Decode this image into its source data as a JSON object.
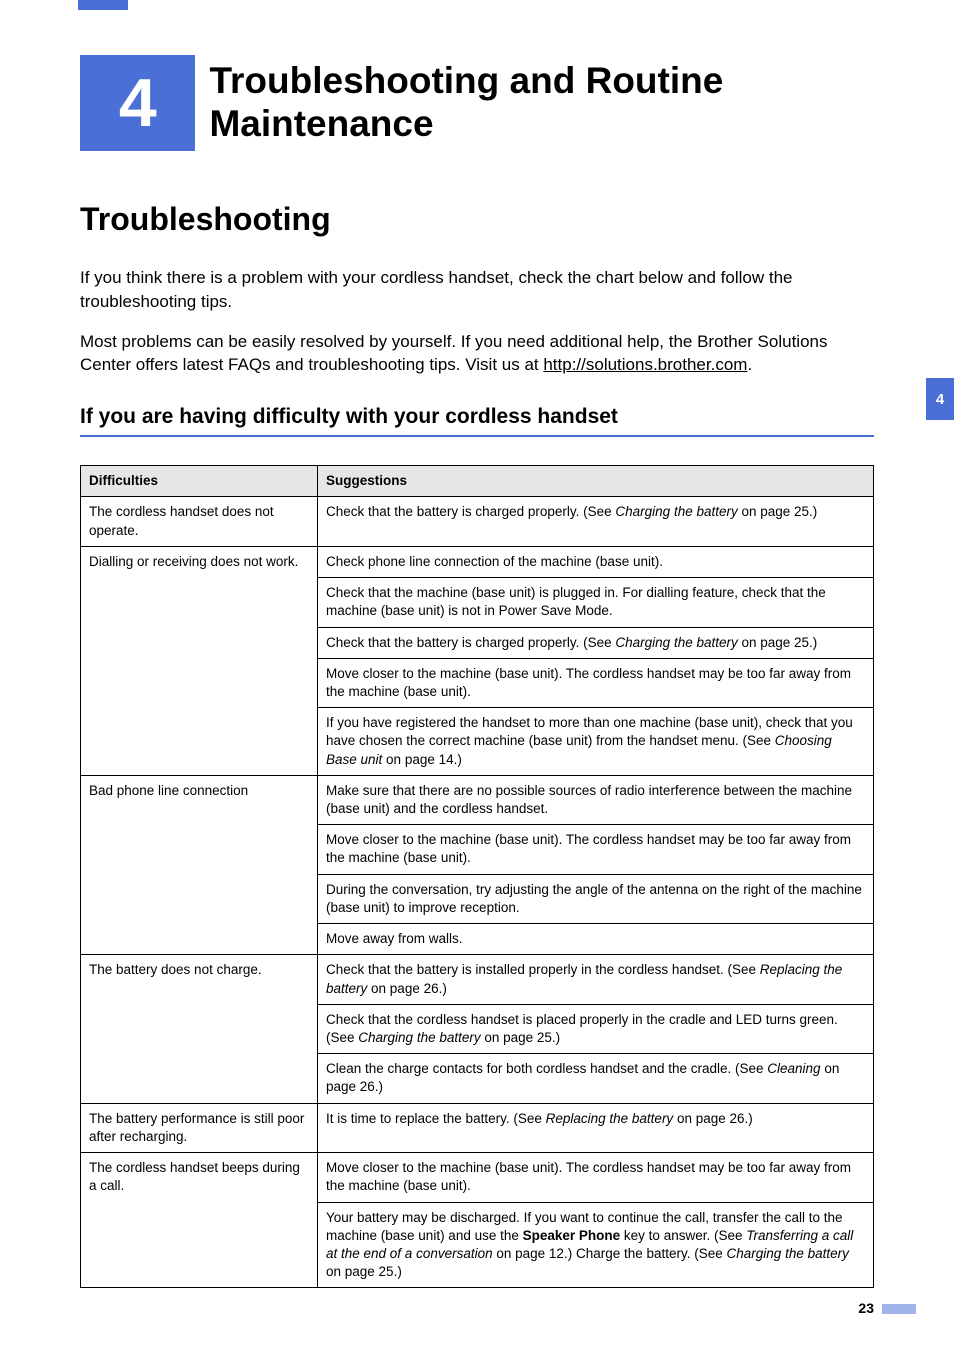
{
  "chapter": {
    "number": "4",
    "title": "Troubleshooting and Routine Maintenance"
  },
  "section": {
    "title": "Troubleshooting"
  },
  "paras": {
    "p1": "If you think there is a problem with your cordless handset, check the chart below and follow the troubleshooting tips.",
    "p2a": "Most problems can be easily resolved by yourself. If you need additional help, the Brother Solutions Center offers latest FAQs and troubleshooting tips. Visit us at ",
    "p2link": "http://solutions.brother.com",
    "p2b": "."
  },
  "subsection": {
    "title": "If you are having difficulty with your cordless handset"
  },
  "sideTab": "4",
  "tableHeaders": {
    "col1": "Difficulties",
    "col2": "Suggestions"
  },
  "rows": [
    {
      "difficulty": "The cordless handset does not operate.",
      "suggestions": [
        {
          "segments": [
            {
              "t": "Check that the battery is charged properly. (See "
            },
            {
              "t": "Charging the battery",
              "style": "italic"
            },
            {
              "t": " on page 25.)"
            }
          ]
        }
      ]
    },
    {
      "difficulty": "Dialling or receiving does not work.",
      "suggestions": [
        {
          "segments": [
            {
              "t": "Check phone line connection of the machine (base unit)."
            }
          ]
        },
        {
          "segments": [
            {
              "t": "Check that the machine (base unit) is plugged in. For dialling feature, check that the machine (base unit) is not in Power Save Mode."
            }
          ]
        },
        {
          "segments": [
            {
              "t": "Check that the battery is charged properly. (See "
            },
            {
              "t": "Charging the battery",
              "style": "italic"
            },
            {
              "t": " on page 25.)"
            }
          ]
        },
        {
          "segments": [
            {
              "t": "Move closer to the machine (base unit). The cordless handset may be too far away from the machine (base unit)."
            }
          ]
        },
        {
          "segments": [
            {
              "t": "If you have registered the handset to more than one machine (base unit), check that you have chosen the correct machine (base unit) from the handset menu. (See "
            },
            {
              "t": "Choosing Base unit",
              "style": "italic"
            },
            {
              "t": " on page 14.)"
            }
          ]
        }
      ]
    },
    {
      "difficulty": "Bad phone line connection",
      "suggestions": [
        {
          "segments": [
            {
              "t": "Make sure that there are no possible sources of radio interference between the machine (base unit) and the cordless handset."
            }
          ]
        },
        {
          "segments": [
            {
              "t": "Move closer to the machine (base unit). The cordless handset may be too far away from the machine (base unit)."
            }
          ]
        },
        {
          "segments": [
            {
              "t": "During the conversation, try adjusting the angle of the antenna on the right of the machine (base unit) to improve reception."
            }
          ]
        },
        {
          "segments": [
            {
              "t": "Move away from walls."
            }
          ]
        }
      ]
    },
    {
      "difficulty": "The battery does not charge.",
      "suggestions": [
        {
          "segments": [
            {
              "t": "Check that the battery is installed properly in the cordless handset. (See "
            },
            {
              "t": "Replacing the battery",
              "style": "italic"
            },
            {
              "t": " on page 26.)"
            }
          ]
        },
        {
          "segments": [
            {
              "t": "Check that the cordless handset is placed properly in the cradle and LED turns green. (See "
            },
            {
              "t": "Charging the battery",
              "style": "italic"
            },
            {
              "t": " on page 25.)"
            }
          ]
        },
        {
          "segments": [
            {
              "t": "Clean the charge contacts for both cordless handset and the cradle. (See "
            },
            {
              "t": "Cleaning",
              "style": "italic"
            },
            {
              "t": " on page 26.)"
            }
          ]
        }
      ]
    },
    {
      "difficulty": "The battery performance is still poor after recharging.",
      "suggestions": [
        {
          "segments": [
            {
              "t": "It is time to replace the battery. (See "
            },
            {
              "t": "Replacing the battery",
              "style": "italic"
            },
            {
              "t": " on page 26.)"
            }
          ]
        }
      ]
    },
    {
      "difficulty": "The cordless handset beeps during a call.",
      "suggestions": [
        {
          "segments": [
            {
              "t": "Move closer to the machine (base unit). The cordless handset may be too far away from the machine (base unit)."
            }
          ]
        },
        {
          "segments": [
            {
              "t": "Your battery may be discharged. If you want to continue the call, transfer the call to the machine (base unit) and use the "
            },
            {
              "t": "Speaker Phone",
              "style": "bold"
            },
            {
              "t": " key to answer. (See "
            },
            {
              "t": "Transferring a call at the end of a conversation",
              "style": "italic"
            },
            {
              "t": " on page 12.) Charge the battery. (See "
            },
            {
              "t": "Charging the battery",
              "style": "italic"
            },
            {
              "t": " on page 25.)"
            }
          ]
        }
      ]
    }
  ],
  "pageNumber": "23"
}
